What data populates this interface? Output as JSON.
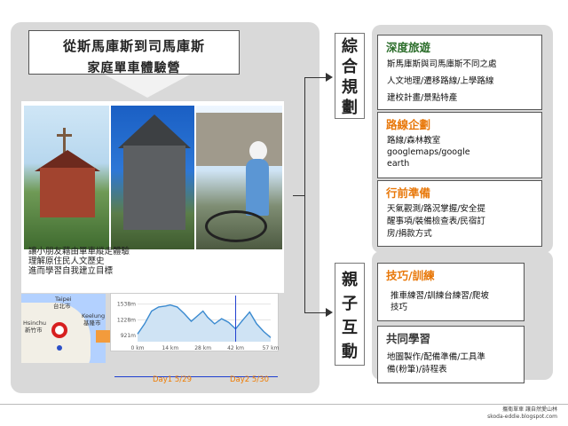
{
  "title": {
    "line1": "從斯馬庫斯到司馬庫斯",
    "line2": "家庭單車體驗營"
  },
  "photo_caption": [
    "讓小朋友藉由單車縱走體驗",
    "理解原住民人文歷史",
    "進而學習自我建立目標"
  ],
  "map": {
    "labels": [
      "Taipei",
      "台北市",
      "Keelung",
      "基隆市",
      "Hsinchu",
      "新竹市"
    ]
  },
  "elevation": {
    "y_ticks": [
      "1538m",
      "1228m",
      "921m"
    ],
    "x_ticks": [
      "0 km",
      "14 km",
      "28 km",
      "42 km",
      "57 km"
    ],
    "day_labels": [
      "Day1 5/29",
      "Day2 5/30"
    ]
  },
  "chart_data": {
    "type": "area",
    "title": "",
    "xlabel": "",
    "ylabel": "",
    "x": [
      0,
      3,
      6,
      9,
      12,
      14,
      17,
      20,
      23,
      26,
      28,
      30,
      33,
      36,
      39,
      42,
      45,
      48,
      51,
      54,
      57
    ],
    "series": [
      {
        "values": [
          950,
          1150,
          1400,
          1480,
          1500,
          1520,
          1480,
          1350,
          1200,
          1320,
          1400,
          1280,
          1150,
          1250,
          1180,
          1050,
          1220,
          1380,
          1150,
          1000,
          880
        ]
      }
    ],
    "ylim": [
      800,
      1600
    ],
    "xlim": [
      0,
      57
    ]
  },
  "categories": [
    {
      "label": [
        "綜",
        "合",
        "規",
        "劃"
      ]
    },
    {
      "label": [
        "親",
        "子",
        "互",
        "動"
      ]
    }
  ],
  "cards": {
    "deep": {
      "title": "深度旅遊",
      "lines": [
        "斯馬庫斯與司馬庫斯不同之處",
        "人文地理/遷移路線/上學路線",
        "建校計畫/景點特產"
      ]
    },
    "route": {
      "title": "路線企劃",
      "lines": [
        "路線/森林教室",
        "googlemaps/google",
        "earth"
      ]
    },
    "prep": {
      "title": "行前準備",
      "lines": [
        "天氣觀測/路況掌握/安全提",
        "醒事項/裝備檢查表/民宿訂",
        "房/捐款方式"
      ]
    },
    "skill": {
      "title": "技巧/訓練",
      "lines": [
        "推車練習/訓練台練習/爬坡",
        "技巧"
      ]
    },
    "learn": {
      "title": "共同學習",
      "lines": [
        "地圖製作/配備準備/工具準",
        "備(粉筆)/詩程表"
      ]
    }
  },
  "footer": {
    "line1": "攜衛單車 讓自然愛山林",
    "line2": "skoda-eddie.blogspot.com"
  },
  "colors": {
    "green": "#2c6e2b",
    "orange": "#e8780a",
    "panel": "#d9d9d9"
  }
}
